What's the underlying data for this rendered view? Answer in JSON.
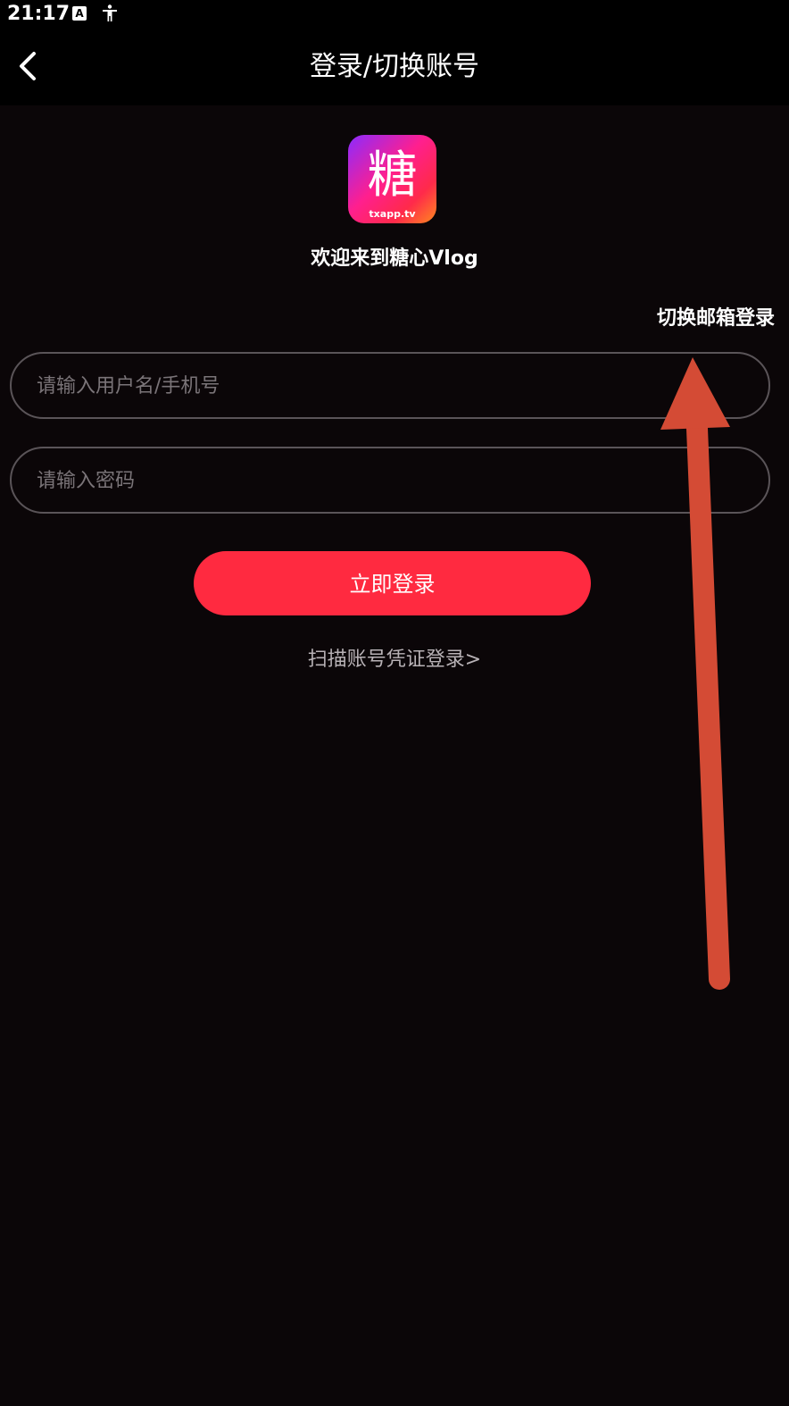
{
  "status_bar": {
    "time": "21:17",
    "icons": [
      "text-a-icon",
      "accessibility-icon"
    ]
  },
  "app_bar": {
    "title": "登录/切换账号",
    "back_icon": "chevron-left-icon"
  },
  "logo": {
    "icon": "app-logo-icon",
    "glyph": "糖",
    "subtitle": "txapp.tv"
  },
  "welcome": "欢迎来到糖心Vlog",
  "switch_email_label": "切换邮箱登录",
  "form": {
    "username_placeholder": "请输入用户名/手机号",
    "username_value": "",
    "password_placeholder": "请输入密码",
    "password_value": ""
  },
  "login_button_label": "立即登录",
  "scan_link_label": "扫描账号凭证登录>",
  "annotation": {
    "icon": "arrow-annotation-icon",
    "color": "#d44b35"
  },
  "colors": {
    "background": "#0b0608",
    "accent": "#ff2a40"
  }
}
